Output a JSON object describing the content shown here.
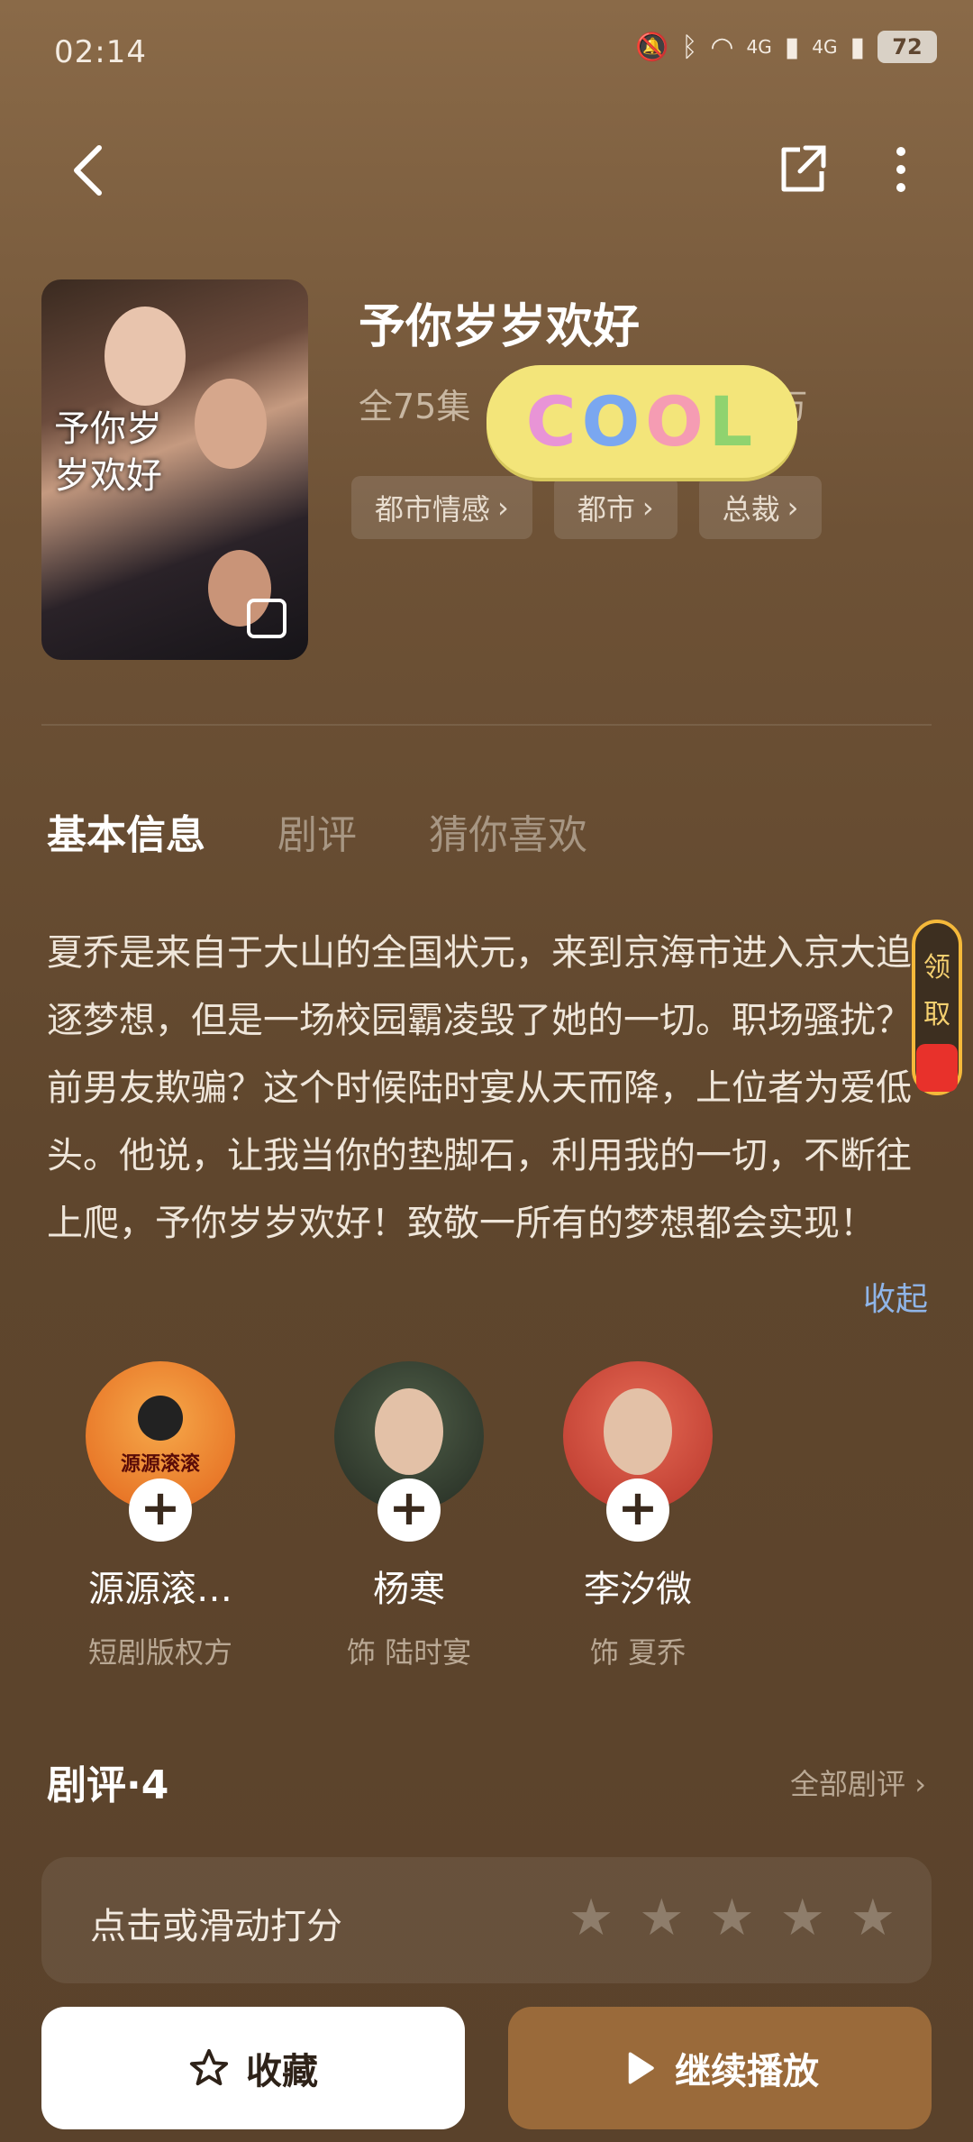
{
  "status": {
    "time": "02:14",
    "battery": "72",
    "network": "4G"
  },
  "drama": {
    "title": "予你岁岁欢好",
    "episodes": "全75集",
    "views": "9万",
    "tags": [
      "都市情感",
      "都市",
      "总裁"
    ],
    "poster_text": "予你岁岁欢好"
  },
  "sticker": {
    "text": [
      "C",
      "O",
      "O",
      "L"
    ]
  },
  "tabs": [
    "基本信息",
    "剧评",
    "猜你喜欢"
  ],
  "description": "夏乔是来自于大山的全国状元，来到京海市进入京大追逐梦想，但是一场校园霸凌毁了她的一切。职场骚扰？前男友欺骗？这个时候陆时宴从天而降，上位者为爱低头。他说，让我当你的垫脚石，利用我的一切，不断往上爬，予你岁岁欢好！致敬一所有的梦想都会实现！",
  "collapse_label": "收起",
  "claim": {
    "line1": "领",
    "line2": "取"
  },
  "cast": [
    {
      "name": "源源滚…",
      "role": "短剧版权方",
      "color": "#f28a2a"
    },
    {
      "name": "杨寒",
      "role": "饰 陆时宴",
      "color": "#2f3a2c"
    },
    {
      "name": "李汐微",
      "role": "饰 夏乔",
      "color": "#d6453a"
    }
  ],
  "cast_badge": "源源滚滚",
  "reviews": {
    "title": "剧评·4",
    "all_label": "全部剧评",
    "rate_label": "点击或滑动打分"
  },
  "buttons": {
    "favorite": "收藏",
    "play": "继续播放"
  }
}
